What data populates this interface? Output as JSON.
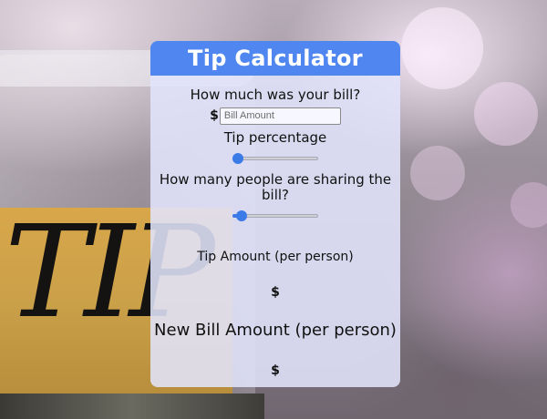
{
  "app": {
    "title": "Tip Calculator"
  },
  "bill": {
    "question": "How much was your bill?",
    "currency_symbol": "$",
    "input_value": "",
    "placeholder": "Bill Amount"
  },
  "tip_percentage": {
    "label": "Tip percentage",
    "slider_fraction": 0.0
  },
  "people": {
    "question": "How many people are sharing the bill?",
    "slider_fraction": 0.05
  },
  "results": {
    "tip_amount_label": "Tip Amount (per person)",
    "tip_amount_value": "$",
    "new_bill_label": "New Bill Amount (per person)",
    "new_bill_value": "$"
  },
  "colors": {
    "header_bg": "#4f86f0",
    "slider_accent": "#3b7be8"
  },
  "background": {
    "jar_label_text": "TIP"
  }
}
